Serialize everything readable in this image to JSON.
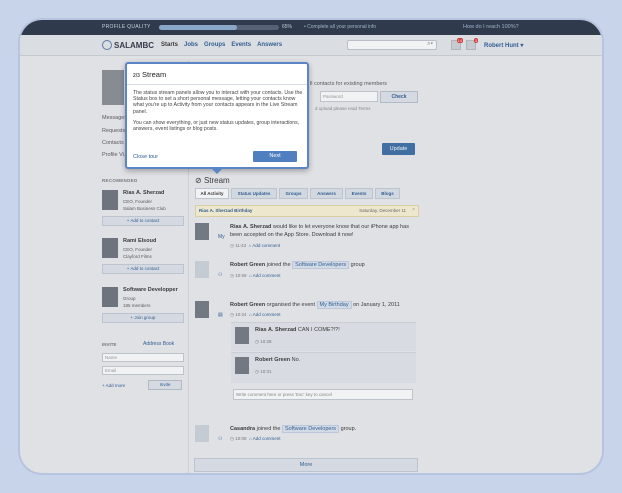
{
  "topbar": {
    "profile_quality": "PROFILE QUALITY",
    "progress_pct": 65,
    "progress_label": "65%",
    "complete_link": "• Complete all your personal info",
    "how_link": "How do I reach 100%?"
  },
  "nav": {
    "logo": "SALAMBC",
    "links": [
      "Starts",
      "Jobs",
      "Groups",
      "Events",
      "Answers"
    ],
    "notif1": "14",
    "notif2": "3",
    "user": "Robert Hunt ▾"
  },
  "sidebar": {
    "links": [
      "Messages",
      "Requests",
      "Contacts",
      "Profile Vi..."
    ],
    "recommended_h": "RECOMENDED",
    "recs": [
      {
        "name": "Rias A. Sherzad",
        "l1": "CEO, Founder",
        "l2": "Salam Business Club",
        "btn": "+ Add to contact"
      },
      {
        "name": "Rami Elsoud",
        "l1": "CEO, Founder",
        "l2": "Clayford Films",
        "btn": "+ Add to contact"
      },
      {
        "name": "Software Developper",
        "l1": "Group",
        "l2": "186 members",
        "btn": "+ Join group"
      }
    ],
    "invite_h": "INVITE",
    "address_book": "Address Book",
    "name_ph": "Name",
    "email_ph": "Email",
    "add_more": "+ Add more",
    "invite_btn": "Invite"
  },
  "import": {
    "contacts_text": "ll contacts for existing members",
    "password_ph": "Password",
    "check_btn": "Check",
    "terms": "d upload please read Terms"
  },
  "status": {
    "update_btn": "Update"
  },
  "stream": {
    "title": "Stream",
    "tabs": [
      "All Activity",
      "Status Updates",
      "Groups",
      "Answers",
      "Events",
      "Blogs"
    ],
    "bday_name": "Rias A. Sherzad Birthday",
    "bday_date": "Saturday, December 11",
    "items": [
      {
        "who": "Rias A. Sherzad",
        "text": " would like to let everyone know that our iPhone app has been accepted on the App Store. Download it now!",
        "time": "11:43",
        "add": "Add comment"
      },
      {
        "who": "Robert Green",
        "pre": " joined the ",
        "tag": "Software Developers",
        "post": " group",
        "time": "10:59",
        "add": "Add comment"
      },
      {
        "who": "Robert Green",
        "pre": " organised the event ",
        "tag": "My Birthday",
        "post": " on January 1, 2011",
        "time": "10:24",
        "add": "Add comment"
      },
      {
        "who": "Casandra",
        "pre": " joined the ",
        "tag": "Software Developers",
        "post": " group.",
        "time": "10:08",
        "add": "Add comment"
      }
    ],
    "sub1": {
      "who": "Rias A. Sherzad",
      "text": " CAN I COME?!?!",
      "time": "10:28"
    },
    "sub2": {
      "who": "Robert Green",
      "text": " No.",
      "time": "10:31"
    },
    "comment_ph": "Write comment here or press 'Esc' key to cancel",
    "more": "More"
  },
  "tour": {
    "step": "2/3",
    "title": "Stream",
    "p1": "The status stream panels allow you to interact with your contacts. Use the Status box to set a short personal message, letting your contacts know what you're up to Activity from your contacts appears in the Live Stream panel.",
    "p2": "You can show everything, or just new status updates, group interactions, answers, event listings or blog posts.",
    "close": "Close tour",
    "next": "Next"
  }
}
